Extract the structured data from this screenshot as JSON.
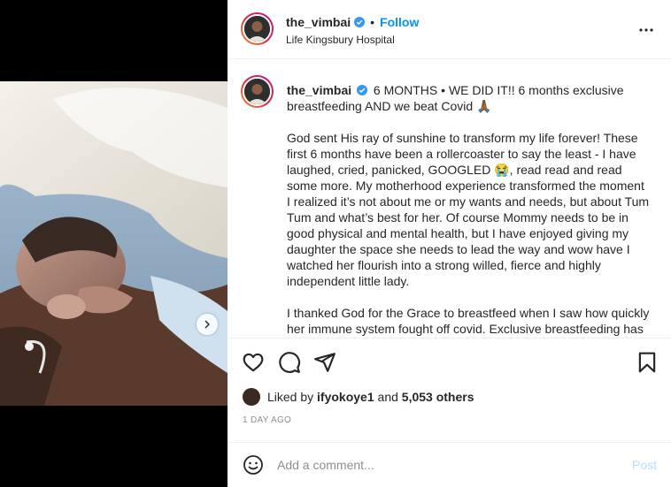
{
  "post": {
    "username": "the_vimbai",
    "dot": "•",
    "follow_label": "Follow",
    "location": "Life Kingsbury Hospital"
  },
  "caption": {
    "username": "the_vimbai",
    "headline": "6 MONTHS • WE DID IT!! 6 months exclusive breastfeeding AND we beat Covid 🙏🏾",
    "paragraph1": "God sent His ray of sunshine to transform my life forever! These first 6 months have been a rollercoaster to say the least - I have laughed, cried, panicked, GOOGLED 😭, read read and read some more. My motherhood experience transformed the moment I realized it’s not about me or my wants and needs, but about Tum Tum and what’s best for her. Of course Mommy needs to be in good physical and mental health, but I have enjoyed giving my daughter the space she needs to lead the way and wow have I watched her flourish into a strong willed, fierce and highly independent little lady.",
    "paragraph2": "I thanked God for the Grace to breastfeed when I saw how quickly her immune system fought off covid. Exclusive breastfeeding has"
  },
  "likes": {
    "prefix": "Liked by",
    "user": "ifyokoye1",
    "and": "and",
    "others": "5,053 others"
  },
  "timestamp": "1 DAY AGO",
  "comment": {
    "placeholder": "Add a comment...",
    "post_label": "Post"
  },
  "colors": {
    "accent": "#0095f6",
    "post_disabled": "#b2dffc",
    "muted": "#8e8e8e",
    "verified": "#3897f0"
  },
  "icons": [
    "chevron-right-icon",
    "verified-badge-icon",
    "more-options-icon",
    "heart-icon",
    "comment-icon",
    "share-icon",
    "bookmark-icon",
    "emoji-icon"
  ]
}
